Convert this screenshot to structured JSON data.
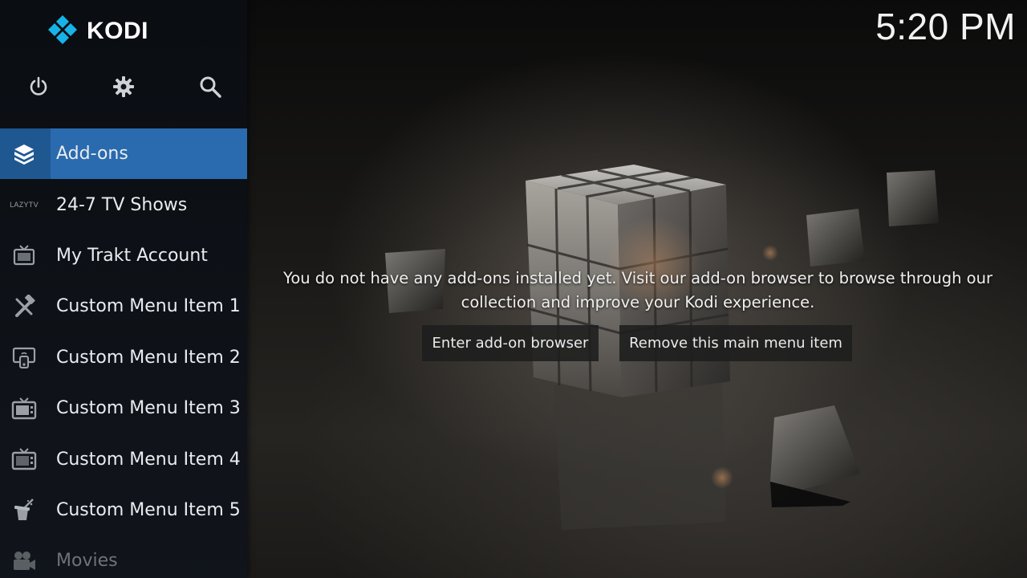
{
  "app": {
    "logo_text": "KODI"
  },
  "clock": {
    "time": "5:20 PM"
  },
  "top_icons": [
    {
      "name": "power-icon"
    },
    {
      "name": "settings-gear-icon"
    },
    {
      "name": "search-icon"
    }
  ],
  "menu": {
    "items": [
      {
        "label": "Add-ons",
        "icon": "addons-box-icon",
        "active": true
      },
      {
        "label": "24-7 TV Shows",
        "icon": "lazytv-icon",
        "icon_text": "LAZYTV"
      },
      {
        "label": "My Trakt Account",
        "icon": "tv-icon"
      },
      {
        "label": "Custom Menu Item 1",
        "icon": "tools-icon"
      },
      {
        "label": "Custom Menu Item 2",
        "icon": "cast-screen-icon"
      },
      {
        "label": "Custom Menu Item 3",
        "icon": "tv-icon"
      },
      {
        "label": "Custom Menu Item 4",
        "icon": "tv-icon"
      },
      {
        "label": "Custom Menu Item 5",
        "icon": "magic-hat-icon"
      },
      {
        "label": "Movies",
        "icon": "movie-camera-icon",
        "dim": true
      }
    ]
  },
  "main": {
    "message": "You do not have any add-ons installed yet. Visit our add-on browser to browse through our collection and improve your Kodi experience.",
    "buttons": {
      "enter": "Enter add-on browser",
      "remove": "Remove this main menu item"
    }
  },
  "colors": {
    "accent": "#2a6aae",
    "sidebar_bg": "#0e1218"
  }
}
